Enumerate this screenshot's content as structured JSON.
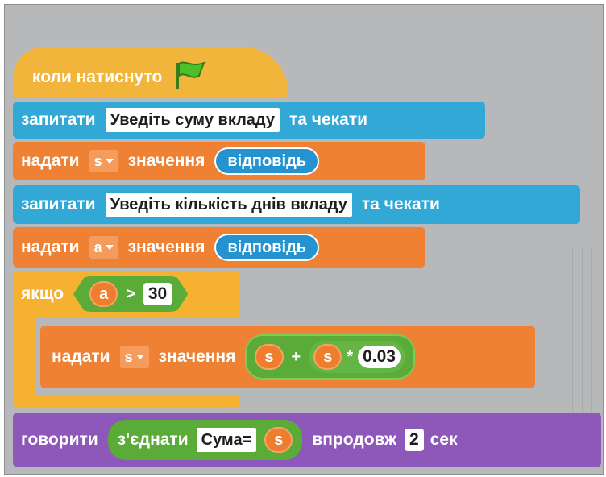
{
  "script": {
    "when_flag_clicked": "коли натиснуто",
    "ask1": {
      "label": "запитати",
      "text": "Уведіть суму вкладу",
      "suffix": "та чекати"
    },
    "set1": {
      "label": "надати",
      "var": "s",
      "mid": "значення",
      "reporter": "відповідь"
    },
    "ask2": {
      "label": "запитати",
      "text": "Уведіть кількість днів вкладу",
      "suffix": "та чекати"
    },
    "set2": {
      "label": "надати",
      "var": "a",
      "mid": "значення",
      "reporter": "відповідь"
    },
    "if_block": {
      "label": "якщо",
      "left": "a",
      "op": ">",
      "right": "30"
    },
    "set3": {
      "label": "надати",
      "var": "s",
      "mid": "значення",
      "a": "s",
      "plus": "+",
      "b": "s",
      "times": "*",
      "c": "0.03"
    },
    "say": {
      "label": "говорити",
      "join": "з'єднати",
      "text": "Сума=",
      "var": "s",
      "mid": "впродовж",
      "secs": "2",
      "unit": "сек"
    }
  },
  "colors": {
    "events": "#f2b53b",
    "sensing": "#31a8d5",
    "data": "#ee8133",
    "control": "#f5b12f",
    "looks": "#8d58b9",
    "operators": "#5aab38",
    "flag": "#4cbf2a"
  },
  "icons": {
    "flag": "green-flag-icon",
    "dropdown": "dropdown-arrow-icon"
  }
}
